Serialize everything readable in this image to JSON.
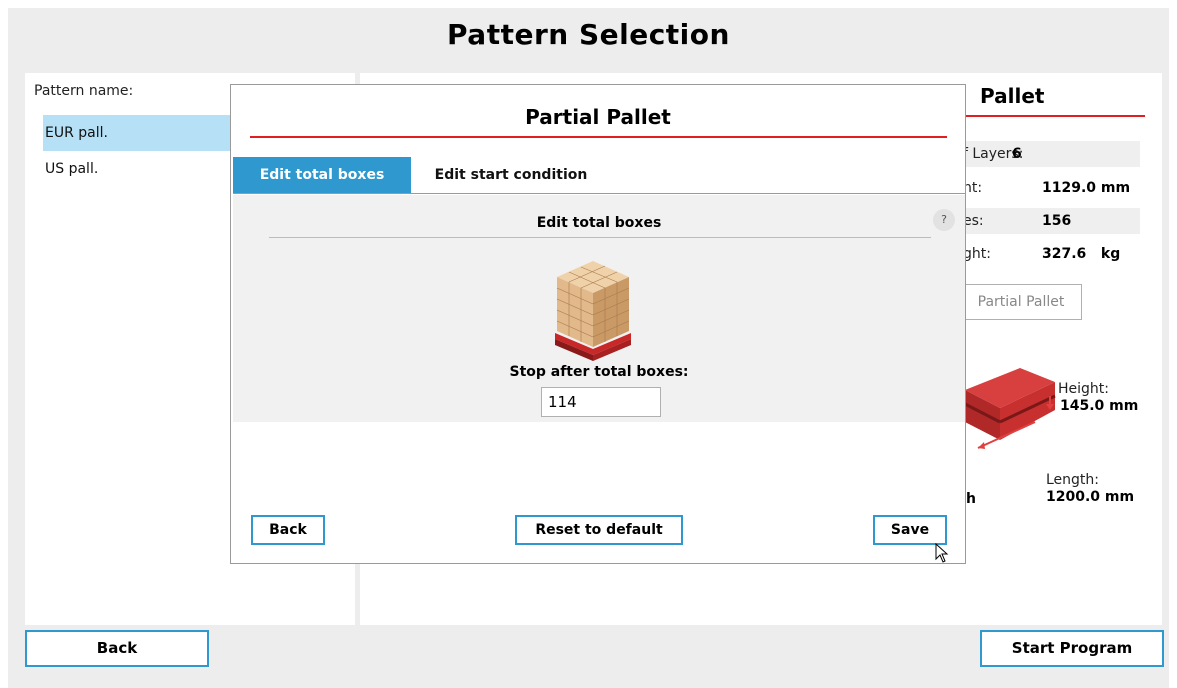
{
  "page": {
    "title": "Pattern Selection"
  },
  "left_panel": {
    "label": "Pattern name:",
    "patterns": [
      {
        "label": "EUR pall.",
        "selected": true
      },
      {
        "label": "US pall.",
        "selected": false
      }
    ]
  },
  "right_panel": {
    "title": "Pallet",
    "info": [
      {
        "label": "f Layers:",
        "value": "6"
      },
      {
        "label": "ht:",
        "value": "1129.0 mm"
      },
      {
        "label": "es:",
        "value": "156"
      },
      {
        "label": "ght:",
        "value": "327.6   kg"
      }
    ],
    "partial_pallet_button": "Partial Pallet",
    "height_label": "Height:",
    "height_value": "145.0 mm",
    "length_label": "Length:",
    "length_value": "1200.0 mm",
    "width_value_fragment": "h"
  },
  "footer": {
    "back_label": "Back",
    "start_label": "Start Program"
  },
  "modal": {
    "title": "Partial Pallet",
    "tabs": [
      {
        "label": "Edit total boxes",
        "active": true
      },
      {
        "label": "Edit start condition",
        "active": false
      }
    ],
    "content_title": "Edit total boxes",
    "help_icon": "?",
    "stop_label": "Stop after total boxes:",
    "total_boxes_value": "114",
    "back_label": "Back",
    "reset_label": "Reset to default",
    "save_label": "Save"
  },
  "colors": {
    "accent_blue": "#2e98cf",
    "selected_row": "#b5e0f5",
    "title_red": "#e02020",
    "pallet_red": "#c82828",
    "box_tan": "#e2b98a"
  }
}
